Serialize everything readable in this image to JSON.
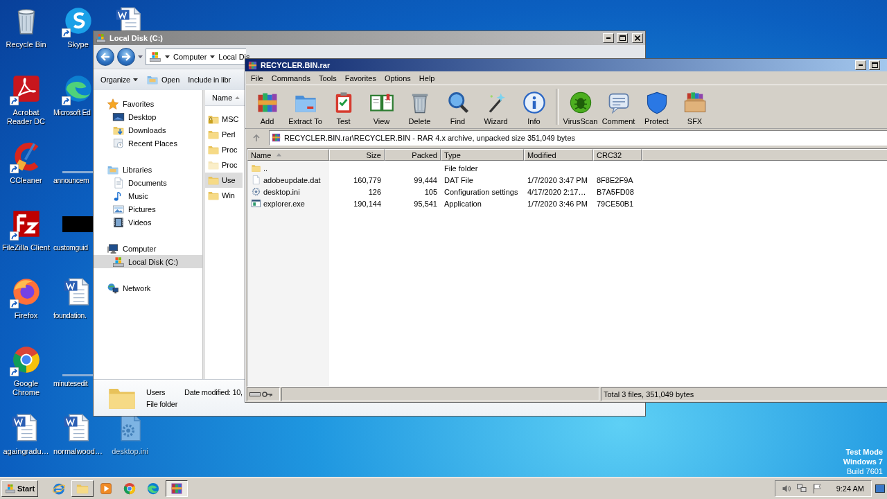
{
  "desktop": {
    "icon_columns": [
      {
        "icons": [
          {
            "label": "Recycle Bin",
            "kind": "bin",
            "shortcut": false,
            "hidden": false
          },
          {
            "label": "Acrobat Reader DC",
            "kind": "pdf",
            "shortcut": true,
            "hidden": false
          },
          {
            "label": "CCleaner",
            "kind": "ccleaner",
            "shortcut": true,
            "hidden": false
          },
          {
            "label": "FileZilla Client",
            "kind": "filezilla",
            "shortcut": true,
            "hidden": false
          },
          {
            "label": "Firefox",
            "kind": "firefox",
            "shortcut": true,
            "hidden": false
          },
          {
            "label": "Google Chrome",
            "kind": "chrome",
            "shortcut": true,
            "hidden": false
          },
          {
            "label": "againgradu…",
            "kind": "doc",
            "shortcut": false,
            "hidden": false
          }
        ]
      },
      {
        "icons": [
          {
            "label": "Skype",
            "kind": "skype",
            "shortcut": true,
            "hidden": false
          },
          {
            "label": "Microsoft Ed",
            "kind": "edge",
            "shortcut": true,
            "hidden": false
          },
          {
            "label": "announcem",
            "kind": "line",
            "shortcut": false,
            "hidden": false
          },
          {
            "label": "customguid",
            "kind": "dark",
            "shortcut": false,
            "hidden": false
          },
          {
            "label": "foundation.",
            "kind": "doc",
            "shortcut": false,
            "hidden": false
          },
          {
            "label": "minutesedit",
            "kind": "line",
            "shortcut": false,
            "hidden": false
          },
          {
            "label": "normalwood…",
            "kind": "doc",
            "shortcut": false,
            "hidden": false
          }
        ]
      },
      {
        "icons": [
          {
            "kind": "doc",
            "shortcut": false,
            "hidden": false
          },
          {
            "label": "desktop.ini",
            "kind": "settings-doc",
            "shortcut": false,
            "hidden": true
          }
        ]
      }
    ],
    "test_mode": [
      "Test Mode",
      "Windows 7",
      "Build 7601"
    ]
  },
  "explorer": {
    "title": "Local Disk (C:)",
    "breadcrumb": [
      "Computer",
      "Local Dis"
    ],
    "toolbar": [
      {
        "label": "Organize",
        "kind": "menu"
      },
      {
        "label": "Open",
        "kind": "open"
      },
      {
        "label": "Include in libr",
        "kind": "plain"
      }
    ],
    "nav": [
      {
        "label": "Favorites",
        "kind": "star",
        "selected": false,
        "children": [
          {
            "label": "Desktop",
            "kind": "desktop",
            "selected": false
          },
          {
            "label": "Downloads",
            "kind": "downloads",
            "selected": false
          },
          {
            "label": "Recent Places",
            "kind": "recent",
            "selected": false
          }
        ]
      },
      {
        "label": "Libraries",
        "kind": "libraries",
        "selected": false,
        "children": [
          {
            "label": "Documents",
            "kind": "documents",
            "selected": false
          },
          {
            "label": "Music",
            "kind": "music",
            "selected": false
          },
          {
            "label": "Pictures",
            "kind": "pictures",
            "selected": false
          },
          {
            "label": "Videos",
            "kind": "videos",
            "selected": false
          }
        ]
      },
      {
        "label": "Computer",
        "kind": "computer",
        "selected": false,
        "children": [
          {
            "label": "Local Disk (C:)",
            "kind": "drive",
            "selected": true
          }
        ]
      },
      {
        "label": "Network",
        "kind": "network",
        "selected": false
      }
    ],
    "list_header": {
      "label": "Name",
      "sorted": true
    },
    "files": [
      {
        "name": "MSC",
        "kind": "locked-folder",
        "selected": false
      },
      {
        "name": "Perl",
        "kind": "folder",
        "selected": false
      },
      {
        "name": "Proc",
        "kind": "folder",
        "selected": false
      },
      {
        "name": "Proc",
        "kind": "hidden-folder",
        "selected": false
      },
      {
        "name": "Use",
        "kind": "folder",
        "selected": true
      },
      {
        "name": "Win",
        "kind": "folder",
        "selected": false
      }
    ],
    "details": {
      "name": "Users",
      "modified": "Date modified: 10,",
      "type": "File folder"
    }
  },
  "winrar": {
    "title": "RECYCLER.BIN.rar",
    "menu": [
      "File",
      "Commands",
      "Tools",
      "Favorites",
      "Options",
      "Help"
    ],
    "toolbar_groups": [
      [
        {
          "label": "Add",
          "kind": "add"
        },
        {
          "label": "Extract To",
          "kind": "extract"
        },
        {
          "label": "Test",
          "kind": "test"
        },
        {
          "label": "View",
          "kind": "view"
        },
        {
          "label": "Delete",
          "kind": "delete"
        },
        {
          "label": "Find",
          "kind": "find"
        },
        {
          "label": "Wizard",
          "kind": "wizard"
        },
        {
          "label": "Info",
          "kind": "info"
        }
      ],
      [
        {
          "label": "VirusScan",
          "kind": "virusscan"
        },
        {
          "label": "Comment",
          "kind": "comment"
        },
        {
          "label": "Protect",
          "kind": "protect"
        },
        {
          "label": "SFX",
          "kind": "sfx"
        }
      ]
    ],
    "path": "RECYCLER.BIN.rar\\RECYCLER.BIN - RAR 4.x archive, unpacked size 351,049 bytes",
    "columns": [
      {
        "label": "Name",
        "sorted": true
      },
      {
        "label": "Size",
        "sorted": false
      },
      {
        "label": "Packed",
        "sorted": false
      },
      {
        "label": "Type",
        "sorted": false
      },
      {
        "label": "Modified",
        "sorted": false
      },
      {
        "label": "CRC32",
        "sorted": false
      }
    ],
    "rows": [
      {
        "kind": "folder",
        "name": "..",
        "size": "",
        "packed": "",
        "type": "File folder",
        "modified": "",
        "crc": ""
      },
      {
        "kind": "dat",
        "name": "adobeupdate.dat",
        "size": "160,779",
        "packed": "99,444",
        "type": "DAT File",
        "modified": "1/7/2020 3:47 PM",
        "crc": "8F8E2F9A"
      },
      {
        "kind": "ini",
        "name": "desktop.ini",
        "size": "126",
        "packed": "105",
        "type": "Configuration settings",
        "modified": "4/17/2020 2:17…",
        "crc": "B7A5FD08"
      },
      {
        "kind": "exe",
        "name": "explorer.exe",
        "size": "190,144",
        "packed": "95,541",
        "type": "Application",
        "modified": "1/7/2020 3:46 PM",
        "crc": "79CE50B1"
      }
    ],
    "status": "Total 3 files, 351,049 bytes"
  },
  "taskbar": {
    "start": "Start",
    "apps": [
      {
        "kind": "ie",
        "open": false,
        "selected": false
      },
      {
        "kind": "explorer",
        "open": true,
        "selected": false
      },
      {
        "kind": "media",
        "open": false,
        "selected": false
      },
      {
        "kind": "chrome",
        "open": false,
        "selected": false
      },
      {
        "kind": "edge",
        "open": false,
        "selected": false
      },
      {
        "kind": "winrar",
        "open": true,
        "selected": true
      }
    ],
    "tray": [
      {
        "kind": "speaker"
      },
      {
        "kind": "network-tray"
      },
      {
        "kind": "flag"
      }
    ],
    "clock": "9:24 AM"
  }
}
